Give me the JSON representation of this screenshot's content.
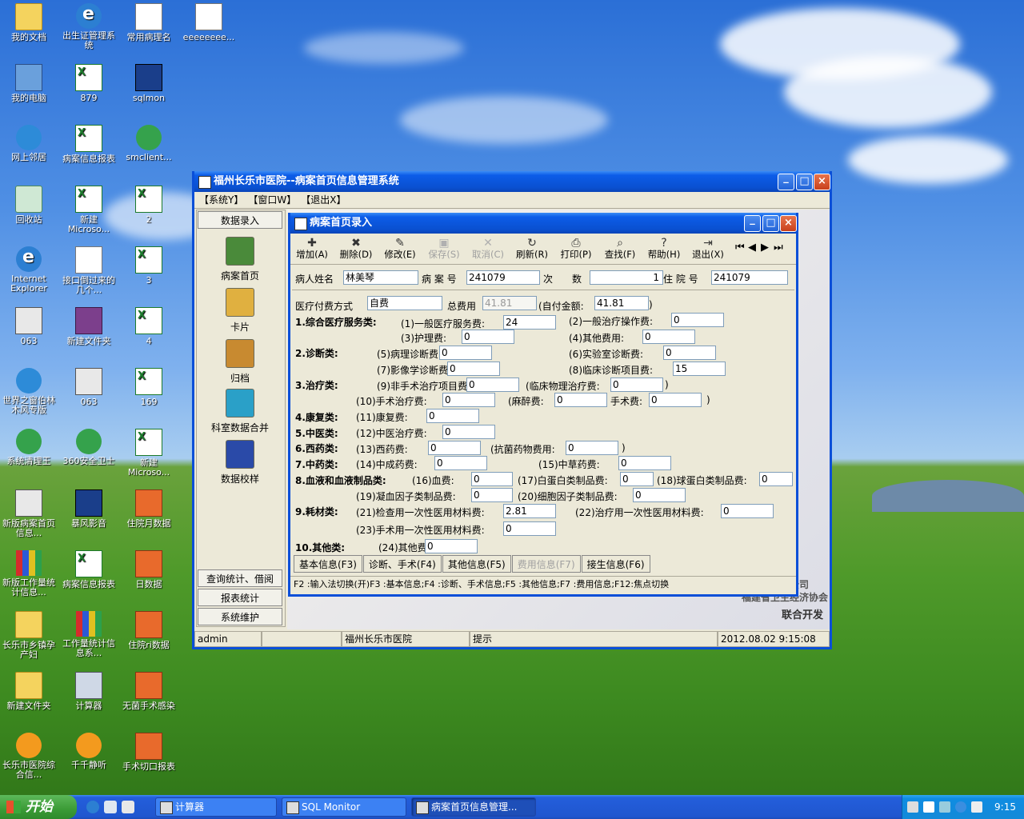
{
  "desktop": {
    "icons": [
      {
        "label": "我的文档",
        "icon": "folder-documents-icon"
      },
      {
        "label": "出生证管理系统",
        "icon": "ie-shortcut-icon"
      },
      {
        "label": "常用病理名",
        "icon": "text-document-icon"
      },
      {
        "label": "eeeeeeee...",
        "icon": "text-document-icon"
      },
      {
        "label": "我的电脑",
        "icon": "my-computer-icon"
      },
      {
        "label": "879",
        "icon": "excel-file-icon"
      },
      {
        "label": "sqlmon",
        "icon": "sql-monitor-icon"
      },
      {
        "label": "网上邻居",
        "icon": "network-places-icon"
      },
      {
        "label": "病案信息报表",
        "icon": "excel-file-icon"
      },
      {
        "label": "smclient...",
        "icon": "setup-icon"
      },
      {
        "label": "回收站",
        "icon": "recycle-bin-icon"
      },
      {
        "label": "新建 Microso...",
        "icon": "excel-file-icon"
      },
      {
        "label": "2",
        "icon": "excel-file-icon"
      },
      {
        "label": "Internet Explorer",
        "icon": "internet-explorer-icon"
      },
      {
        "label": "接口倒过来的几个...",
        "icon": "word-document-icon"
      },
      {
        "label": "3",
        "icon": "excel-file-icon"
      },
      {
        "label": "063",
        "icon": "app-shortcut-icon"
      },
      {
        "label": "新建文件夹",
        "icon": "winrar-archive-icon"
      },
      {
        "label": "4",
        "icon": "excel-file-icon"
      },
      {
        "label": "世界之窗伯林木风专版",
        "icon": "world-browser-icon"
      },
      {
        "label": "063",
        "icon": "app-shortcut-icon"
      },
      {
        "label": "169",
        "icon": "excel-file-icon"
      },
      {
        "label": "系统清理王",
        "icon": "system-cleaner-icon"
      },
      {
        "label": "360安全卫士",
        "icon": "360-safe-icon"
      },
      {
        "label": "新建 Microso...",
        "icon": "excel-file-icon"
      },
      {
        "label": "新版病案首页信息...",
        "icon": "app-shortcut-icon"
      },
      {
        "label": "暴风影音",
        "icon": "media-player-icon"
      },
      {
        "label": "住院月数据",
        "icon": "report-file-icon"
      },
      {
        "label": "新版工作量统计信息...",
        "icon": "bar-chart-icon"
      },
      {
        "label": "病案信息报表",
        "icon": "excel-file-icon"
      },
      {
        "label": "日数据",
        "icon": "report-file-icon"
      },
      {
        "label": "长乐市乡镇孕产妇",
        "icon": "folder-icon"
      },
      {
        "label": "工作量统计信息系...",
        "icon": "bar-chart-icon"
      },
      {
        "label": "住院ri数据",
        "icon": "report-file-icon"
      },
      {
        "label": "新建文件夹",
        "icon": "folder-icon"
      },
      {
        "label": "计算器",
        "icon": "calculator-icon"
      },
      {
        "label": "无菌手术感染",
        "icon": "report-file-icon"
      },
      {
        "label": "长乐市医院综合信...",
        "icon": "hospital-app-icon"
      },
      {
        "label": "千千静听",
        "icon": "music-player-icon"
      },
      {
        "label": "手术切口报表",
        "icon": "report-file-icon"
      }
    ]
  },
  "main_window": {
    "title": "福州长乐市医院--病案首页信息管理系统",
    "menu": [
      "【系统Y】",
      "【窗口W】",
      "【退出X】"
    ],
    "nav_top": "数据录入",
    "nav_items": [
      {
        "label": "病案首页",
        "icon": "books-icon",
        "color": "#4a8a3a"
      },
      {
        "label": "卡片",
        "icon": "card-folder-icon",
        "color": "#e0b040"
      },
      {
        "label": "归档",
        "icon": "archive-folder-icon",
        "color": "#c88a30"
      },
      {
        "label": "科室数据合并",
        "icon": "recycle-merge-icon",
        "color": "#2aa0c8"
      },
      {
        "label": "数据校样",
        "icon": "checklist-icon",
        "color": "#2a4aa8"
      }
    ],
    "nav_bottom": [
      "查询统计、借阅",
      "报表统计",
      "系统维护"
    ],
    "bg_text": [
      "限公司",
      "福建省卫生经济协会",
      "联合开发"
    ],
    "status": [
      "admin",
      "",
      "福州长乐市医院",
      "提示",
      "2012.08.02 9:15:08"
    ]
  },
  "form": {
    "title": "病案首页录入",
    "toolbar": [
      {
        "label": "增加(A)",
        "icon": "add-icon",
        "enabled": true
      },
      {
        "label": "删除(D)",
        "icon": "delete-icon",
        "enabled": true
      },
      {
        "label": "修改(E)",
        "icon": "edit-icon",
        "enabled": true
      },
      {
        "label": "保存(S)",
        "icon": "save-icon",
        "enabled": false
      },
      {
        "label": "取消(C)",
        "icon": "cancel-icon",
        "enabled": false
      },
      {
        "label": "刷新(R)",
        "icon": "refresh-icon",
        "enabled": true
      },
      {
        "label": "打印(P)",
        "icon": "print-icon",
        "enabled": true
      },
      {
        "label": "查找(F)",
        "icon": "find-icon",
        "enabled": true
      },
      {
        "label": "帮助(H)",
        "icon": "help-icon",
        "enabled": true
      },
      {
        "label": "退出(X)",
        "icon": "exit-icon",
        "enabled": true
      }
    ],
    "header": {
      "name_label": "病人姓名",
      "name": "林美琴",
      "caseno_label": "病 案 号",
      "caseno": "241079",
      "times_label": "次　　数",
      "times": "1",
      "inpatient_label": "住 院 号",
      "inpatient": "241079"
    },
    "payment": {
      "label": "医疗付费方式",
      "value": "自费",
      "total_label": "总费用",
      "total": "41.81",
      "self_label": "(自付金额:",
      "self": "41.81",
      "close": ")"
    },
    "categories": {
      "c1": "1.综合医疗服务类:",
      "c2": "2.诊断类:",
      "c3": "3.治疗类:",
      "c4": "4.康复类:",
      "c5": "5.中医类:",
      "c6": "6.西药类:",
      "c7": "7.中药类:",
      "c8": "8.血液和血液制品类:",
      "c9": "9.耗材类:",
      "c10": "10.其他类:"
    },
    "items": {
      "i1": {
        "label": "(1)一般医疗服务费:",
        "value": "24"
      },
      "i2": {
        "label": "(2)一般治疗操作费:",
        "value": "0"
      },
      "i3": {
        "label": "(3)护理费:",
        "value": "0"
      },
      "i4": {
        "label": "(4)其他费用:",
        "value": "0"
      },
      "i5": {
        "label": "(5)病理诊断费:",
        "value": "0"
      },
      "i6": {
        "label": "(6)实验室诊断费:",
        "value": "0"
      },
      "i7": {
        "label": "(7)影像学诊断费:",
        "value": "0"
      },
      "i8": {
        "label": "(8)临床诊断项目费:",
        "value": "15"
      },
      "i9": {
        "label": "(9)非手术治疗项目费:",
        "value": "0"
      },
      "i9a": {
        "label": "(临床物理治疗费:",
        "value": "0",
        "close": ")"
      },
      "i10": {
        "label": "(10)手术治疗费:",
        "value": "0"
      },
      "i10a": {
        "label": "(麻醉费:",
        "value": "0"
      },
      "i10b": {
        "label": "手术费:",
        "value": "0",
        "close": ")"
      },
      "i11": {
        "label": "(11)康复费:",
        "value": "0"
      },
      "i12": {
        "label": "(12)中医治疗费:",
        "value": "0"
      },
      "i13": {
        "label": "(13)西药费:",
        "value": "0"
      },
      "i13a": {
        "label": "(抗菌药物费用:",
        "value": "0",
        "close": ")"
      },
      "i14": {
        "label": "(14)中成药费:",
        "value": "0"
      },
      "i15": {
        "label": "(15)中草药费:",
        "value": "0"
      },
      "i16": {
        "label": "(16)血费:",
        "value": "0"
      },
      "i17": {
        "label": "(17)白蛋白类制品费:",
        "value": "0"
      },
      "i18": {
        "label": "(18)球蛋白类制品费:",
        "value": "0"
      },
      "i19": {
        "label": "(19)凝血因子类制品费:",
        "value": "0"
      },
      "i20": {
        "label": "(20)细胞因子类制品费:",
        "value": "0"
      },
      "i21": {
        "label": "(21)检查用一次性医用材料费:",
        "value": "2.81"
      },
      "i22": {
        "label": "(22)治疗用一次性医用材料费:",
        "value": "0"
      },
      "i23": {
        "label": "(23)手术用一次性医用材料费:",
        "value": "0"
      },
      "i24": {
        "label": "(24)其他费:",
        "value": "0"
      }
    },
    "tabs": [
      {
        "label": "基本信息(F3)",
        "enabled": true
      },
      {
        "label": "诊断、手术(F4)",
        "enabled": true
      },
      {
        "label": "其他信息(F5)",
        "enabled": true
      },
      {
        "label": "费用信息(F7)",
        "enabled": false
      },
      {
        "label": "接生信息(F6)",
        "enabled": true
      }
    ],
    "help": "F2 :输入法切换(开)F3 :基本信息;F4 :诊断、手术信息;F5 :其他信息;F7 :费用信息;F12:焦点切换"
  },
  "taskbar": {
    "start": "开始",
    "tasks": [
      {
        "label": "计算器",
        "active": false
      },
      {
        "label": "SQL Monitor",
        "active": false
      },
      {
        "label": "病案首页信息管理...",
        "active": true
      }
    ],
    "clock": "9:15"
  },
  "colors": {
    "title_blue": "#0a50d0",
    "face": "#ece9d8",
    "taskbar": "#245edb",
    "start_green": "#3b9b36"
  }
}
